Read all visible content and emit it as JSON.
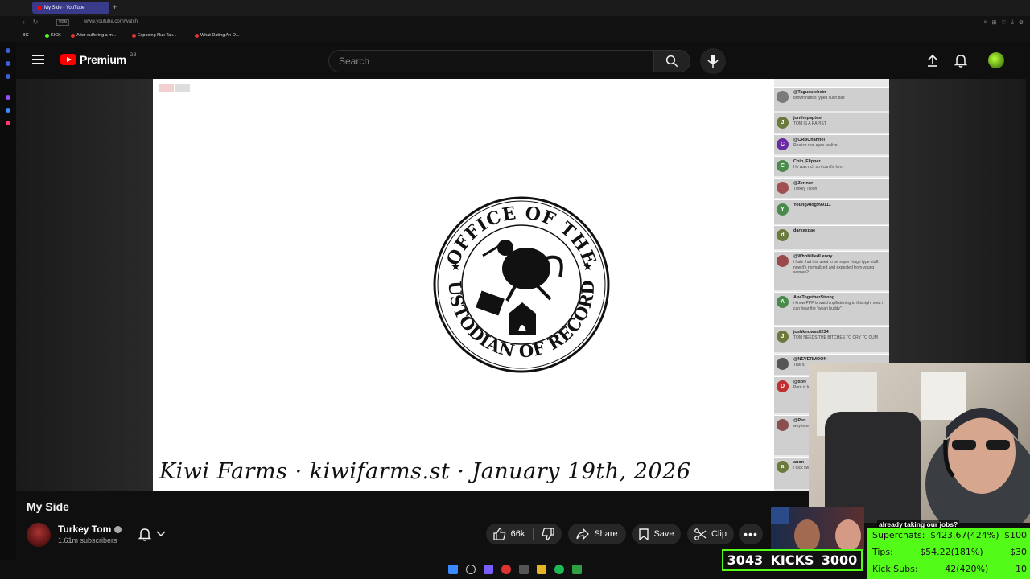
{
  "browser": {
    "tab_title": "My Side - YouTube",
    "url": "www.youtube.com/watch",
    "vpn_label": "VPN",
    "bookmarks": [
      {
        "label": "BC"
      },
      {
        "label": "KICK"
      },
      {
        "label": "After suffering a m..."
      },
      {
        "label": "Exposing Nux Tak..."
      },
      {
        "label": "What Dating An O..."
      }
    ]
  },
  "header": {
    "logo_text": "Premium",
    "region": "GB",
    "search_placeholder": "Search"
  },
  "video": {
    "caption": "Kiwi Farms · kiwifarms.st · January 19th, 2026",
    "seal_top": "OFFICE OF THE",
    "seal_bottom": "CUSTODIAN OF RECORDS"
  },
  "chat": {
    "messages": [
      {
        "name": "@Tagueulehein",
        "text": "brown hands typed such bait",
        "initial": "",
        "color": "#7a7a7a"
      },
      {
        "name": "jonthepaptest",
        "text": "TOM IS A RAPIST",
        "initial": "J",
        "color": "#6b7a3a"
      },
      {
        "name": "@CRBChannel",
        "text": "Realize real eyes realize",
        "initial": "C",
        "color": "#6a2aa0"
      },
      {
        "name": "Coin_Flipper",
        "text": "He was rich so i can fix him",
        "initial": "C",
        "color": "#4a8a4a"
      },
      {
        "name": "@Zerinor",
        "text": "Turkey Troon",
        "initial": "",
        "color": "#a05050"
      },
      {
        "name": "YoungAlog999111",
        "text": "",
        "initial": "Y",
        "color": "#4a8a4a"
      },
      {
        "name": "darkexpae",
        "text": "",
        "initial": "d",
        "color": "#6b7a3a"
      },
      {
        "name": "@WhoKilledLenny",
        "text": "i hate that this used to be super fringe type stuff. now it's normalized and expected from young women?",
        "initial": "",
        "color": "#9a4a4a"
      },
      {
        "name": "ApeTogetherStrong",
        "text": "i know PPP is watching/listening to this right now. i can hear the \"woah buddy\"",
        "initial": "A",
        "color": "#4a8a4a"
      },
      {
        "name": "joshknowsall234",
        "text": "TOM NEEDS THE BITCHES TO CRY TO CUM",
        "initial": "J",
        "color": "#6b7a3a"
      },
      {
        "name": "@NEVERMOON",
        "text": "That's",
        "initial": "",
        "color": "#555"
      },
      {
        "name": "@dori",
        "text": "Porn is Killer, Skin killer",
        "initial": "D",
        "color": "#c03030"
      },
      {
        "name": "@Pen",
        "text": "why is women to you incon",
        "initial": "",
        "color": "#8a5050"
      },
      {
        "name": "anon",
        "text": "i fuck swee repe",
        "initial": "a",
        "color": "#6b7a3a"
      }
    ]
  },
  "below_video": {
    "title": "My Side",
    "channel_name": "Turkey Tom",
    "subscribers": "1.61m subscribers",
    "likes": "66k",
    "share_label": "Share",
    "save_label": "Save",
    "clip_label": "Clip"
  },
  "stream": {
    "banner": "already taking our jobs?",
    "kicks_current": "3043",
    "kicks_label": "KICKS",
    "kicks_goal": "3000",
    "superchats_label": "Superchats:",
    "superchats_value": "$423.67(424%)",
    "superchats_goal": "$100",
    "tips_label": "Tips:",
    "tips_value": "$54.22(181%)",
    "tips_goal": "$30",
    "kicksubs_label": "Kick Subs:",
    "kicksubs_value": "42(420%)",
    "kicksubs_goal": "10"
  },
  "colors": {
    "yt_red": "#ff0000",
    "kick_green": "#53fc18",
    "background": "#0f0f0f"
  }
}
